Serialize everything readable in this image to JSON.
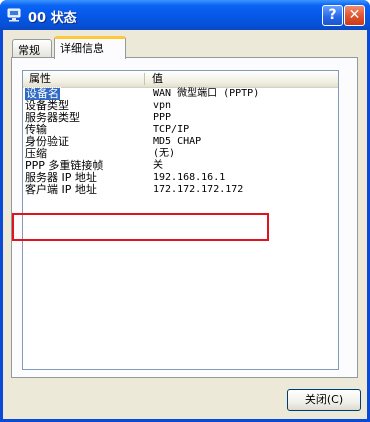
{
  "window": {
    "title": "00 状态",
    "help_glyph": "?",
    "close_glyph": "✕"
  },
  "tabs": [
    {
      "label": "常规",
      "active": false
    },
    {
      "label": "详细信息",
      "active": true
    }
  ],
  "details": {
    "columns": [
      "属性",
      "值"
    ],
    "rows": [
      {
        "property": "设备名",
        "value": "WAN 微型端口 (PPTP)",
        "selected": true
      },
      {
        "property": "设备类型",
        "value": "vpn"
      },
      {
        "property": "服务器类型",
        "value": "PPP"
      },
      {
        "property": "传输",
        "value": "TCP/IP"
      },
      {
        "property": "身份验证",
        "value": "MD5 CHAP"
      },
      {
        "property": "压缩",
        "value": "(无)"
      },
      {
        "property": "PPP 多重链接帧",
        "value": "关"
      },
      {
        "property": "服务器 IP 地址",
        "value": "192.168.16.1",
        "highlighted": true
      },
      {
        "property": "客户端 IP 地址",
        "value": "172.172.172.172",
        "highlighted": true
      }
    ]
  },
  "buttons": {
    "close_label": "关闭(C)"
  },
  "colors": {
    "title_bar": "#0a5ad8",
    "highlight_border": "#e0141e",
    "selection": "#316ac5"
  }
}
